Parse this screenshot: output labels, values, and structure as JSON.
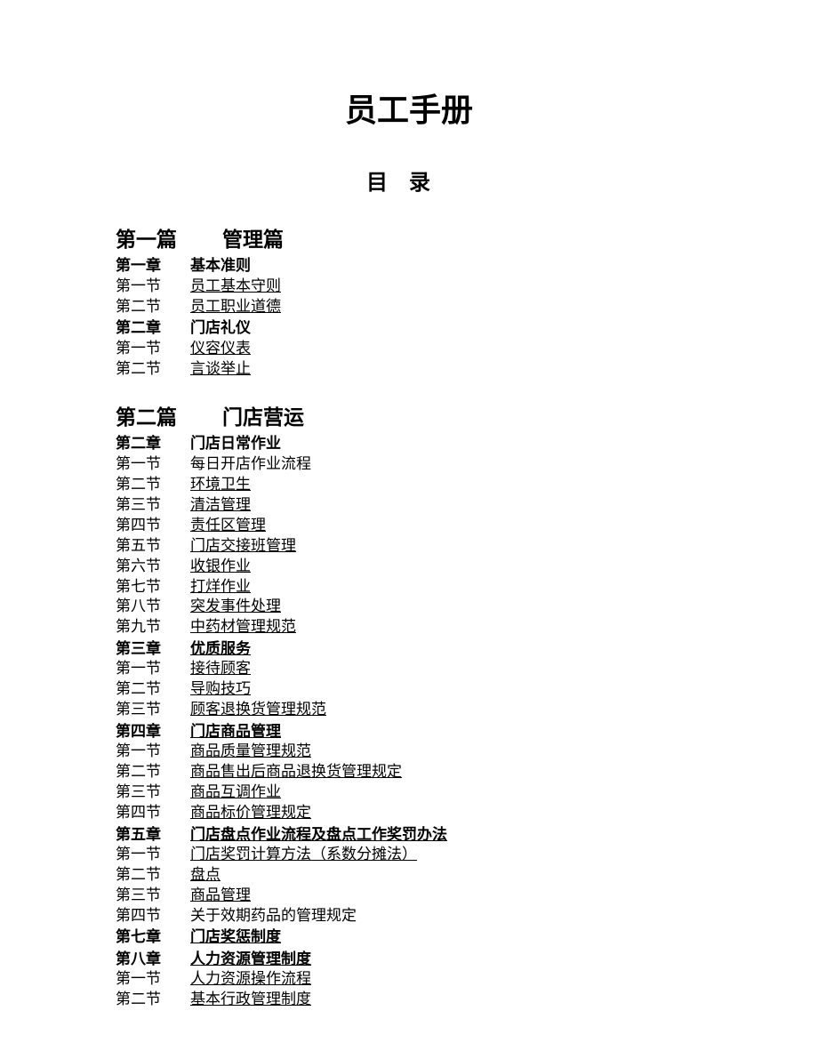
{
  "title": "员工手册",
  "toc_heading": "目录",
  "parts": [
    {
      "label": "第一篇",
      "title": "管理篇",
      "chapters": [
        {
          "label": "第一章",
          "title": "基本准则",
          "underlined": false,
          "sections": [
            {
              "label": "第一节",
              "title": "员工基本守则",
              "underlined": true
            },
            {
              "label": "第二节",
              "title": "员工职业道德",
              "underlined": true
            }
          ]
        },
        {
          "label": "第二章",
          "title": "门店礼仪",
          "underlined": false,
          "sections": [
            {
              "label": "第一节",
              "title": "仪容仪表",
              "underlined": true
            },
            {
              "label": "第二节",
              "title": "言谈举止",
              "underlined": true
            }
          ]
        }
      ]
    },
    {
      "label": "第二篇",
      "title": "门店营运",
      "chapters": [
        {
          "label": "第二章",
          "title": "门店日常作业",
          "underlined": false,
          "sections": [
            {
              "label": "第一节",
              "title": "每日开店作业流程",
              "underlined": false
            },
            {
              "label": "第二节",
              "title": "环境卫生",
              "underlined": true
            },
            {
              "label": "第三节",
              "title": "清洁管理",
              "underlined": true
            },
            {
              "label": "第四节",
              "title": "责任区管理",
              "underlined": true
            },
            {
              "label": "第五节",
              "title": "门店交接班管理",
              "underlined": true
            },
            {
              "label": "第六节",
              "title": "收银作业",
              "underlined": true
            },
            {
              "label": "第七节",
              "title": "打烊作业",
              "underlined": true
            },
            {
              "label": "第八节",
              "title": "突发事件处理",
              "underlined": true
            },
            {
              "label": "第九节",
              "title": "中药材管理规范",
              "underlined": true
            }
          ]
        },
        {
          "label": "第三章",
          "title": "优质服务",
          "underlined": true,
          "sections": [
            {
              "label": "第一节",
              "title": "接待顾客",
              "underlined": true
            },
            {
              "label": "第二节",
              "title": "导购技巧",
              "underlined": true
            },
            {
              "label": "第三节",
              "title": "顾客退换货管理规范",
              "underlined": true
            }
          ]
        },
        {
          "label": "第四章",
          "title": "门店商品管理",
          "underlined": true,
          "sections": [
            {
              "label": "第一节",
              "title": "商品质量管理规范",
              "underlined": true
            },
            {
              "label": "第二节",
              "title": "商品售出后商品退换货管理规定",
              "underlined": true
            },
            {
              "label": "第三节",
              "title": "商品互调作业",
              "underlined": true
            },
            {
              "label": "第四节",
              "title": "商品标价管理规定",
              "underlined": true
            }
          ]
        },
        {
          "label": "第五章",
          "title": "门店盘点作业流程及盘点工作奖罚办法",
          "underlined": true,
          "sections": [
            {
              "label": "第一节",
              "title": "门店奖罚计算方法（系数分摊法）",
              "underlined": true
            },
            {
              "label": "第二节",
              "title": "盘点",
              "underlined": true
            },
            {
              "label": "第三节",
              "title": "商品管理",
              "underlined": true
            },
            {
              "label": "第四节",
              "title": "关于效期药品的管理规定",
              "underlined": false
            }
          ]
        },
        {
          "label": "第七章",
          "title": "门店奖惩制度",
          "underlined": true,
          "sections": []
        },
        {
          "label": "第八章",
          "title": "人力资源管理制度",
          "underlined": true,
          "sections": [
            {
              "label": "第一节",
              "title": "人力资源操作流程",
              "underlined": true
            },
            {
              "label": "第二节",
              "title": "基本行政管理制度",
              "underlined": true
            }
          ]
        }
      ]
    }
  ]
}
